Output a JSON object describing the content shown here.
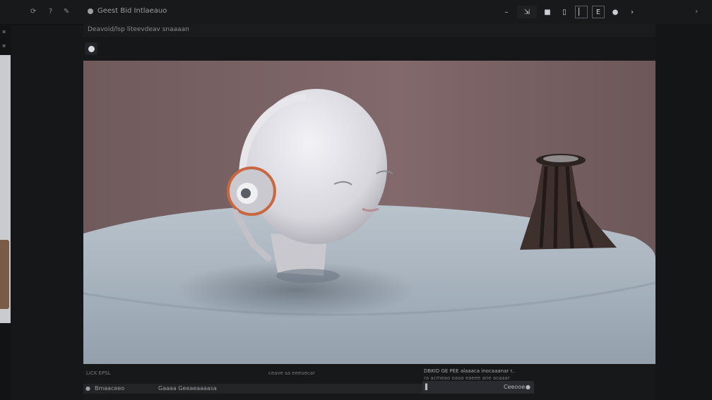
{
  "topbar": {
    "title": "Geest Bid Intlaeauo",
    "left_icons": [
      "refresh-icon",
      "help-icon",
      "edit-icon"
    ],
    "right_icons": [
      "menu-icon",
      "expand-icon",
      "square-icon",
      "frame-icon",
      "panel-icon",
      "layout-icon",
      "brush-icon",
      "more-icon"
    ]
  },
  "subbar": {
    "breadcrumb": "Deavoid/lsp liteevdeav snaaaan"
  },
  "canvas": {
    "description_icon": "eye-icon"
  },
  "footer": {
    "col1_line1": "LICK EPSL",
    "col2_line1": "ceave sa eeeuecar",
    "col3_line1": "DBKID GE PEE alaaaca inocaaanar r..",
    "col3_line2": "ra acmeao oaaa eaeee ane acaaar",
    "status_left": "Bmaaceeo",
    "status_mid": "Gaaaa Geeaeaaaasa",
    "zoom_label": "Ceeooe"
  },
  "colors": {
    "background": "#161718",
    "wall": "#7b6466",
    "cloth": "#a7b1ba",
    "head": "#e5e5ea"
  }
}
